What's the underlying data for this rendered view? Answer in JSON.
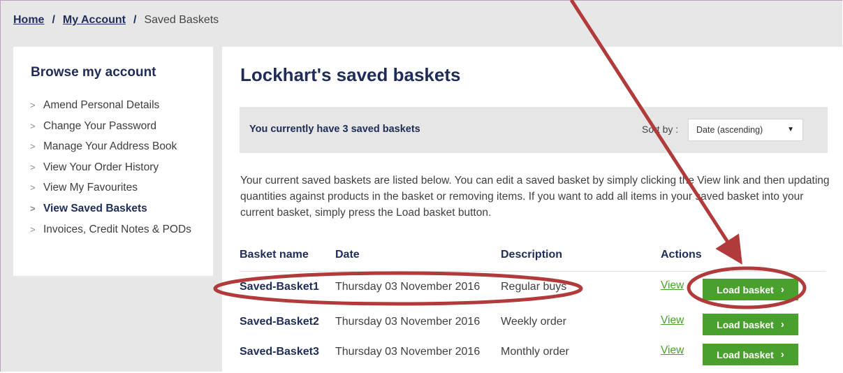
{
  "breadcrumb": {
    "home": "Home",
    "sep1": "/",
    "account": "My Account",
    "sep2": "/",
    "current": "Saved Baskets"
  },
  "sidebar": {
    "title": "Browse my account",
    "items": [
      {
        "label": "Amend Personal Details",
        "active": false
      },
      {
        "label": "Change Your Password",
        "active": false
      },
      {
        "label": "Manage Your Address Book",
        "active": false
      },
      {
        "label": "View Your Order History",
        "active": false
      },
      {
        "label": "View My Favourites",
        "active": false
      },
      {
        "label": "View Saved Baskets",
        "active": true
      },
      {
        "label": "Invoices, Credit Notes & PODs",
        "active": false
      }
    ]
  },
  "main": {
    "title": "Lockhart's saved baskets",
    "summary": "You currently have 3 saved baskets",
    "sort_label": "Sort by :",
    "sort_value": "Date (ascending)",
    "intro": "Your current saved baskets are listed below.  You can edit a saved basket by simply clicking the View link and then updating quantities against products in the basket or removing items.  If you want to add all items in your saved basket into your current basket, simply press the Load basket button.",
    "headers": {
      "name": "Basket name",
      "date": "Date",
      "description": "Description",
      "actions": "Actions"
    },
    "rows": [
      {
        "name": "Saved-Basket1",
        "date": "Thursday 03 November 2016",
        "description": "Regular buys",
        "view": "View",
        "load": "Load basket"
      },
      {
        "name": "Saved-Basket2",
        "date": "Thursday 03 November 2016",
        "description": "Weekly order",
        "view": "View",
        "load": "Load basket"
      },
      {
        "name": "Saved-Basket3",
        "date": "Thursday 03 November 2016",
        "description": "Monthly order",
        "view": "View",
        "load": "Load basket"
      }
    ]
  },
  "colors": {
    "navy": "#1f2c57",
    "green": "#4aa02c",
    "annotation": "#b13a3a"
  },
  "icons": {
    "list_bullet": "chevron-right-icon",
    "select_caret": "caret-down-icon",
    "button_chevron": "chevron-right-icon"
  }
}
